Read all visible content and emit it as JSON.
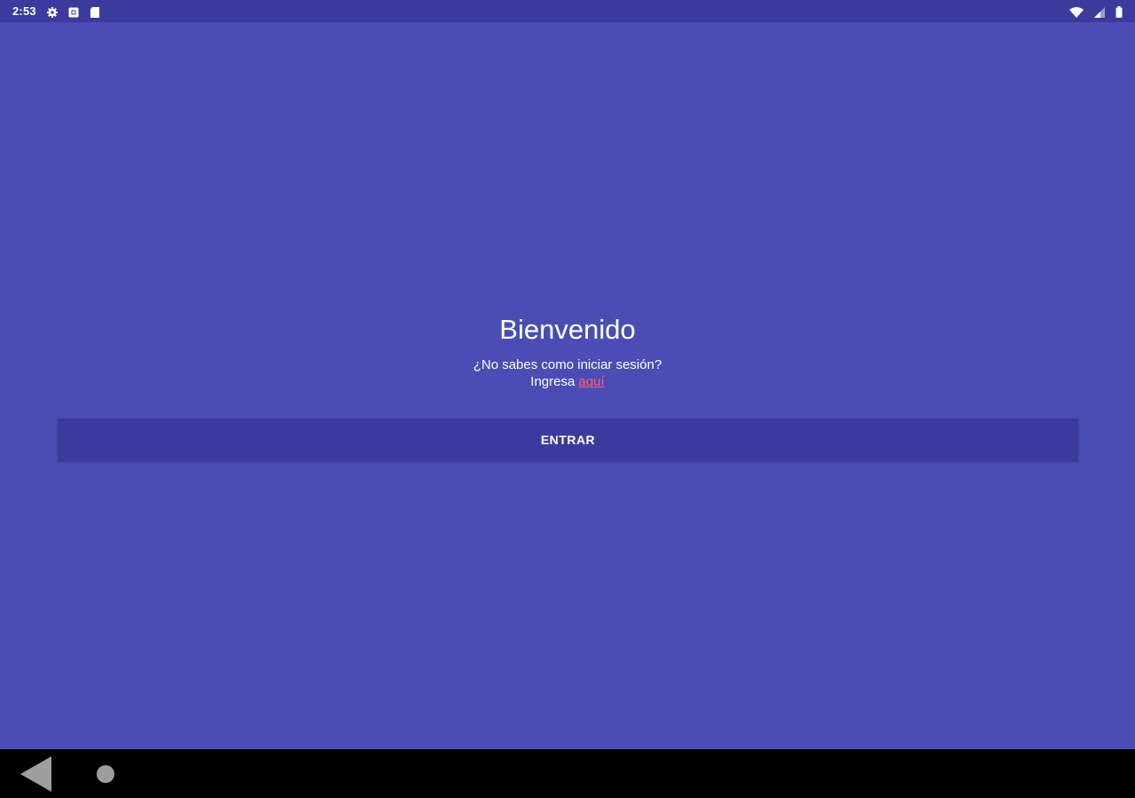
{
  "status_bar": {
    "time": "2:53",
    "left_icons": [
      "gear-icon",
      "notification-box-icon",
      "sd-card-icon"
    ],
    "right_icons": [
      "wifi-icon",
      "cell-signal-icon",
      "battery-icon"
    ]
  },
  "welcome": {
    "title": "Bienvenido",
    "subtitle": "¿No sabes como iniciar sesión?",
    "prompt_text": "Ingresa",
    "link_text": "aquí"
  },
  "actions": {
    "enter_label": "ENTRAR"
  },
  "nav_bar": {
    "icons": [
      "back-icon",
      "home-icon"
    ]
  },
  "colors": {
    "background": "#4a4db3",
    "status_bar": "#3b3b9e",
    "button": "#3b3b9f",
    "link": "#ff5a7a",
    "nav_bar": "#000000"
  }
}
